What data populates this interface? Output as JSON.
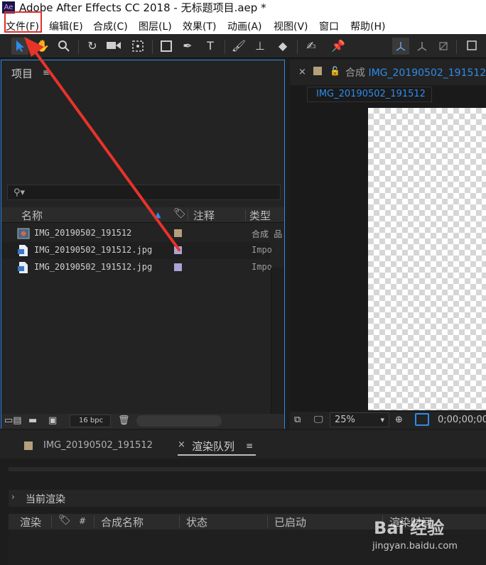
{
  "app": {
    "title": "Adobe After Effects CC 2018 - 无标题项目.aep *",
    "logo_text": "Ae"
  },
  "menu": {
    "items": [
      "文件(F)",
      "编辑(E)",
      "合成(C)",
      "图层(L)",
      "效果(T)",
      "动画(A)",
      "视图(V)",
      "窗口",
      "帮助(H)"
    ]
  },
  "project": {
    "panel_title": "项目",
    "columns": {
      "name": "名称",
      "comment": "注释",
      "type": "类型"
    },
    "files": [
      {
        "name": "IMG_20190502_191512",
        "type": "合成",
        "color": "#b5a07c",
        "icon": "composition-icon"
      },
      {
        "name": "IMG_20190502_191512.jpg",
        "type": "Impo",
        "color": "#a9a5d6",
        "icon": "image-file-icon"
      },
      {
        "name": "IMG_20190502_191512.jpg",
        "type": "Impo",
        "color": "#a9a5d6",
        "icon": "image-file-icon"
      }
    ],
    "bpc_label": "16 bpc"
  },
  "composition": {
    "tab_prefix": "合成",
    "tab_name": "IMG_20190502_191512",
    "breadcrumb": "IMG_20190502_191512",
    "zoom": "25%",
    "timecode": "0;00;00;00"
  },
  "render": {
    "comp_tab": "IMG_20190502_191512",
    "queue_tab": "渲染队列",
    "current_render": "当前渲染",
    "columns": {
      "render": "渲染",
      "number": "#",
      "comp_name": "合成名称",
      "status": "状态",
      "started": "已启动",
      "render_time": "渲染时间"
    }
  },
  "watermark": {
    "logo": "Bai 经验",
    "url": "jingyan.baidu.com"
  },
  "colors": {
    "accent": "#2d8ceb",
    "highlight": "#e0302c",
    "comp_label": "#b5a07c",
    "footage_label": "#a9a5d6"
  }
}
